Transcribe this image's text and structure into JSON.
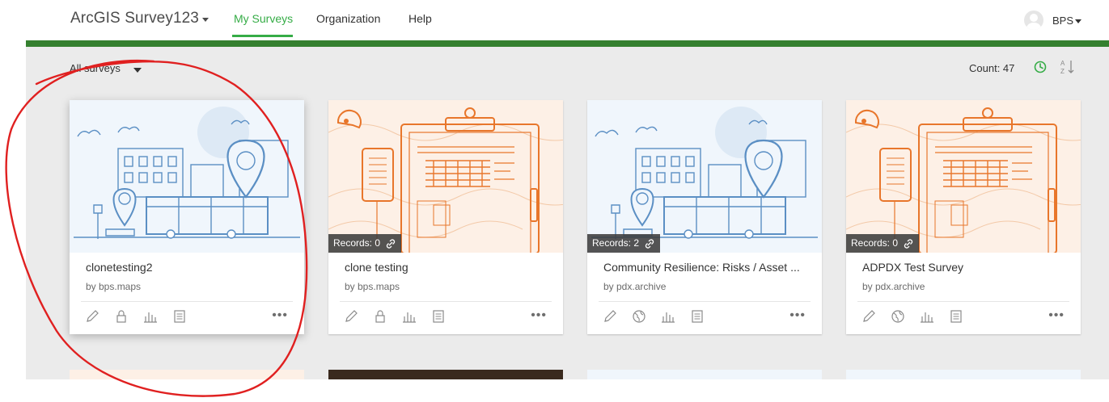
{
  "header": {
    "app_title": "ArcGIS Survey123",
    "nav": [
      {
        "label": "My Surveys",
        "active": true
      },
      {
        "label": "Organization",
        "active": false
      },
      {
        "label": "Help",
        "active": false
      }
    ],
    "user_name": "BPS",
    "accent_color": "#35ac46",
    "bar_color": "#35802f"
  },
  "toolbar": {
    "filter_label": "All surveys",
    "count_label": "Count: 47",
    "clock_icon": "clock-icon",
    "sort_icon": "sort-alpha-icon"
  },
  "surveys": [
    {
      "title": "clonetesting2",
      "owner": "by bps.maps",
      "thumbnail": "city-bus-illustration",
      "records": "",
      "share_icon": "lock-icon"
    },
    {
      "title": "clone testing",
      "owner": "by bps.maps",
      "thumbnail": "clipboard-illustration",
      "records": "Records: 0",
      "share_icon": "lock-icon"
    },
    {
      "title": "Community Resilience: Risks / Asset ...",
      "owner": "by pdx.archive",
      "thumbnail": "city-bus-illustration",
      "records": "Records: 2",
      "share_icon": "globe-icon"
    },
    {
      "title": "ADPDX Test Survey",
      "owner": "by pdx.archive",
      "thumbnail": "clipboard-illustration",
      "records": "Records: 0",
      "share_icon": "globe-icon"
    }
  ],
  "card_actions": [
    "edit-icon",
    "share-icon",
    "analyze-icon",
    "data-icon"
  ],
  "more_label": "•••",
  "annotation": {
    "shape": "hand-drawn circle",
    "color": "#e02020"
  }
}
